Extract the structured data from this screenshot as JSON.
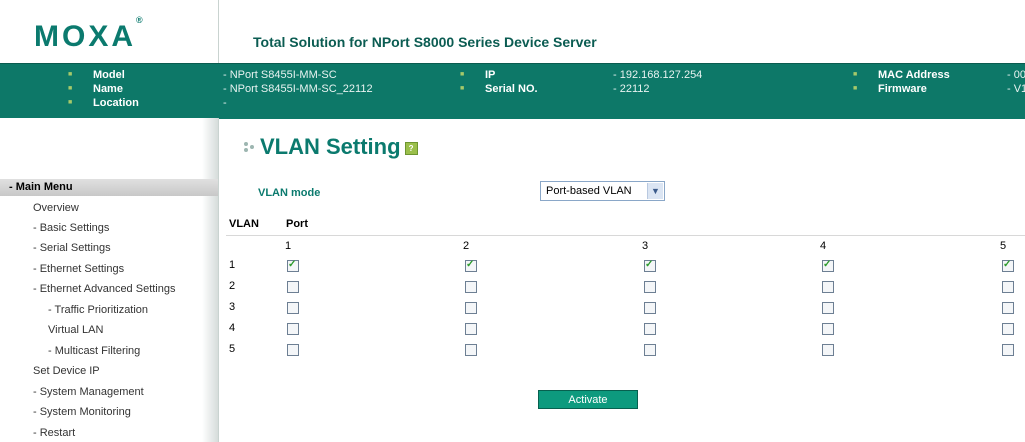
{
  "header": {
    "logo": "MOXA",
    "logo_mark": "®",
    "banner": "Total Solution for NPort S8000 Series Device Server"
  },
  "info": {
    "model_label": "Model",
    "model_value": "- NPort S8455I-MM-SC",
    "name_label": "Name",
    "name_value": "- NPort S8455I-MM-SC_22112",
    "location_label": "Location",
    "location_value": "-",
    "ip_label": "IP",
    "ip_value": "- 192.168.127.254",
    "serial_label": "Serial NO.",
    "serial_value": "- 22112",
    "mac_label": "MAC Address",
    "mac_value": "- 00",
    "firmware_label": "Firmware",
    "firmware_value": "- V1"
  },
  "menu": {
    "header": "- Main Menu",
    "items": [
      "Overview",
      "- Basic Settings",
      "- Serial Settings",
      "- Ethernet Settings",
      "- Ethernet Advanced Settings",
      "- Traffic Prioritization",
      "Virtual LAN",
      "- Multicast Filtering",
      "Set Device IP",
      "- System Management",
      "- System Monitoring",
      "- Restart"
    ]
  },
  "page": {
    "title": "VLAN Setting",
    "help_icon": "?"
  },
  "vlan": {
    "mode_label": "VLAN mode",
    "mode_value": "Port-based VLAN",
    "col_vlan": "VLAN",
    "col_port": "Port",
    "ports": [
      "1",
      "2",
      "3",
      "4",
      "5"
    ],
    "rows": [
      {
        "vlan": "1",
        "checked": [
          true,
          true,
          true,
          true,
          true
        ]
      },
      {
        "vlan": "2",
        "checked": [
          false,
          false,
          false,
          false,
          false
        ]
      },
      {
        "vlan": "3",
        "checked": [
          false,
          false,
          false,
          false,
          false
        ]
      },
      {
        "vlan": "4",
        "checked": [
          false,
          false,
          false,
          false,
          false
        ]
      },
      {
        "vlan": "5",
        "checked": [
          false,
          false,
          false,
          false,
          false
        ]
      }
    ],
    "activate": "Activate"
  },
  "colors": {
    "brand": "#0b7a6e",
    "info_bar": "#0d7868",
    "button": "#0d9a7e",
    "check": "#2b9a2b"
  }
}
